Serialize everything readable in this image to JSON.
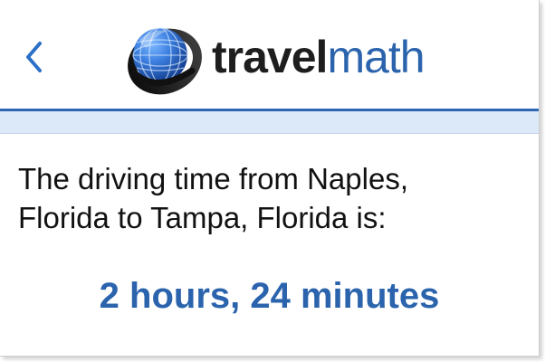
{
  "header": {
    "back_icon": "chevron-left-icon",
    "logo": {
      "icon": "globe-icon",
      "text_travel": "travel",
      "text_math": "math"
    }
  },
  "result": {
    "line1": "The driving time from Naples,",
    "line2": "Florida to Tampa, Florida is:",
    "value": "2 hours, 24 minutes"
  },
  "colors": {
    "accent": "#2b64ad",
    "bar_fill": "#dbe9f8",
    "bar_border": "#2f66b3",
    "text": "#111111"
  }
}
